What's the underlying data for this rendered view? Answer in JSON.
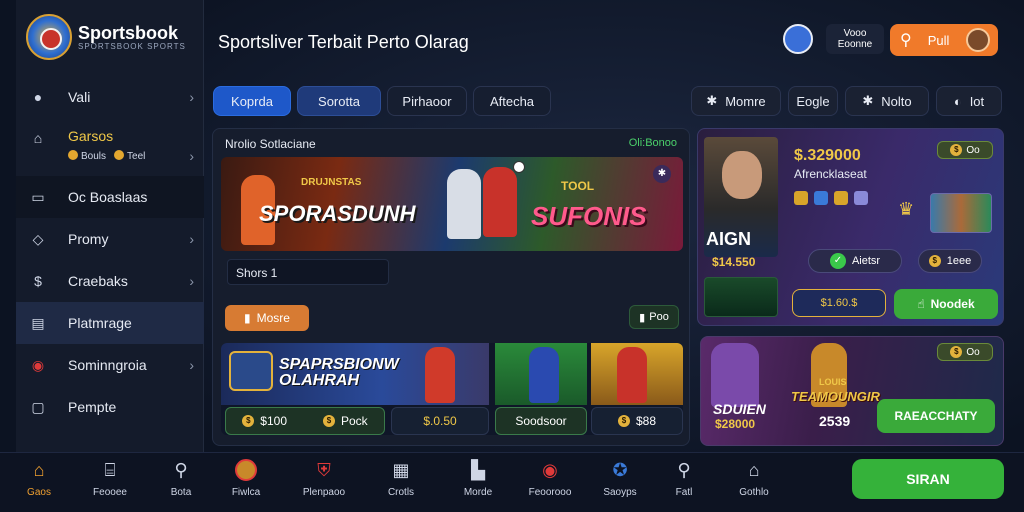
{
  "brand": {
    "name": "Sportsbook",
    "tagline": "SPORTSBOOK SPORTS"
  },
  "header": {
    "title": "Sportsliver Terbait Perto Olarag",
    "user_label_line1": "Vooo",
    "user_label_line2": "Eoonne",
    "search_label": "Pull"
  },
  "sidebar": {
    "items": [
      {
        "label": "Vali"
      },
      {
        "label": "Garsos",
        "sub1": "Bouls",
        "sub2": "Teel"
      },
      {
        "label": "Oc Boaslaas"
      },
      {
        "label": "Promy"
      },
      {
        "label": "Craebaks"
      },
      {
        "label": "Platmrage"
      },
      {
        "label": "Sominngroia"
      },
      {
        "label": "Pempte"
      }
    ]
  },
  "tabs": [
    "Koprda",
    "Sorotta",
    "Pirhaoor",
    "Aftecha"
  ],
  "right_tabs": [
    {
      "label": "Momre",
      "icon": "gear-icon"
    },
    {
      "label": "Eogle",
      "icon": "bookmark-icon"
    },
    {
      "label": "Nolto",
      "icon": "gear-icon"
    },
    {
      "label": "Iot",
      "icon": "clock-icon"
    }
  ],
  "main": {
    "title": "Nrolio Sotlaciane",
    "badge": "Oli:Bonoo",
    "hero_left": "SPORASDUNH",
    "hero_left_sub": "DRUJNSTAS",
    "hero_right": "SUFONIS",
    "hero_right_sub": "TOOL",
    "input_value": "Shors 1",
    "orange_pill": "Mosre",
    "dark_pill": "Poo",
    "promo_title_1": "SPAPRSBIONW",
    "promo_title_2": "OLAHRAH",
    "odds": [
      {
        "label": "$100",
        "coin": "$"
      },
      {
        "label": "Pock",
        "coin": "$"
      },
      {
        "label": "$.0.50",
        "coin": ""
      },
      {
        "label": "Soodsoor",
        "coin": "$"
      },
      {
        "label": "$88",
        "coin": "$"
      }
    ]
  },
  "card1": {
    "player_name": "AIGN",
    "player_value": "$14.550",
    "big_value": "$.329000",
    "subtitle": "Afrencklaseat",
    "badge": "Oo",
    "pill1": "Aietsr",
    "pill2": "1eee",
    "pill3": "$1.60.$",
    "button": "Noodek"
  },
  "card2": {
    "badge": "Oo",
    "left_title": "SDUIEN",
    "left_value": "$28000",
    "right_title": "TEAMOUNGIR",
    "right_title_sub": "LOUIS",
    "right_value": "2539",
    "button": "RAEACCHATY"
  },
  "bottombar": {
    "items": [
      {
        "label": "Gaos",
        "icon": "home-icon"
      },
      {
        "label": "Feooee",
        "icon": "bank-icon"
      },
      {
        "label": "Bota",
        "icon": "search-icon"
      },
      {
        "label": "Fiwlca",
        "icon": "avatar-icon"
      },
      {
        "label": "Plenpaoo",
        "icon": "shield-icon"
      },
      {
        "label": "Crotls",
        "icon": "grid-icon"
      },
      {
        "label": "Morde",
        "icon": "chart-icon"
      },
      {
        "label": "Feoorooo",
        "icon": "ball-icon"
      },
      {
        "label": "Saoyps",
        "icon": "badge-icon"
      },
      {
        "label": "Fatl",
        "icon": "search-icon"
      },
      {
        "label": "Gothlo",
        "icon": "house-icon"
      }
    ],
    "cta": "SIRAN"
  },
  "colors": {
    "accent_orange": "#f07a2a",
    "accent_green": "#35b23a",
    "accent_blue": "#1e58c9",
    "gold": "#f0c848"
  }
}
